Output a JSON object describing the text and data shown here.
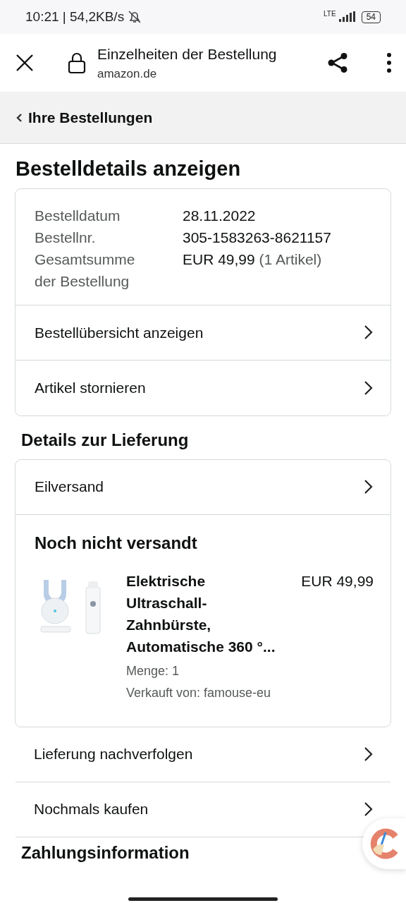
{
  "status_bar": {
    "time": "10:21 | 54,2KB/s",
    "network": "LTE",
    "battery": "54"
  },
  "browser": {
    "title": "Einzelheiten der Bestellung",
    "domain": "amazon.de"
  },
  "breadcrumb": "Ihre Bestellungen",
  "heading": "Bestelldetails anzeigen",
  "order_summary": {
    "fields": [
      {
        "label": "Bestelldatum",
        "value": "28.11.2022"
      },
      {
        "label": "Bestellnr.",
        "value": "305-1583263-8621157"
      },
      {
        "label": "Gesamtsumme der Bestellung",
        "value": "EUR 49,99",
        "note": "(1 Artikel)"
      }
    ],
    "links": [
      "Bestellübersicht anzeigen",
      "Artikel stornieren"
    ]
  },
  "delivery": {
    "heading": "Details zur Lieferung",
    "shipping": "Eilversand",
    "status": "Noch nicht versandt",
    "item": {
      "kind": "picture",
      "title": "Elektrische Ultraschall-Zahnbürste, Automatische 360 °...",
      "price": "EUR 49,99",
      "quantity": "Menge: 1",
      "seller": "Verkauft von: famouse-eu"
    }
  },
  "actions": [
    "Lieferung nachverfolgen",
    "Nochmals kaufen"
  ],
  "next_heading": "Zahlungsinformation"
}
